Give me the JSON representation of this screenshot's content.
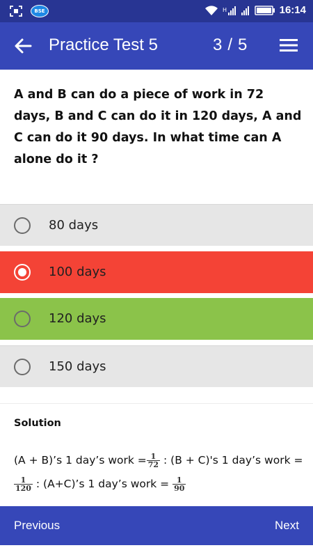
{
  "status_bar": {
    "time": "16:14",
    "notification_badge": "BSE",
    "icons": [
      "screenshot-icon",
      "bse-app-icon",
      "wifi-icon",
      "signal-icon",
      "signal-icon",
      "battery-icon"
    ]
  },
  "app_bar": {
    "title": "Practice Test 5",
    "current": "3",
    "separator": "/",
    "total": "5",
    "back_icon": "arrow-left-icon",
    "menu_icon": "hamburger-menu-icon"
  },
  "question": {
    "text": "A and B can do a piece of work in 72 days, B and C can do it in 120 days, A and C can do it 90 days. In what time can A alone do it ?"
  },
  "options": [
    {
      "label": "80 days",
      "state": "default"
    },
    {
      "label": "100 days",
      "state": "selected-wrong"
    },
    {
      "label": "120 days",
      "state": "correct"
    },
    {
      "label": "150 days",
      "state": "default"
    }
  ],
  "solution": {
    "title": "Solution",
    "l1_a": "(A + B)’s 1 day’s work =",
    "f1_num": "1",
    "f1_den": "72",
    "l1_b": " : (B + C)'s 1 day’s work =",
    "f2_num": "1",
    "f2_den": "120",
    "l2_b": " : (A+C)’s 1 day’s  work = ",
    "f3_num": "1",
    "f3_den": "90"
  },
  "bottom_nav": {
    "previous": "Previous",
    "next": "Next"
  },
  "colors": {
    "primary": "#3647b8",
    "status_bar": "#283593",
    "wrong": "#f44336",
    "correct": "#8bc34a",
    "neutral_option": "#e6e6e6"
  }
}
